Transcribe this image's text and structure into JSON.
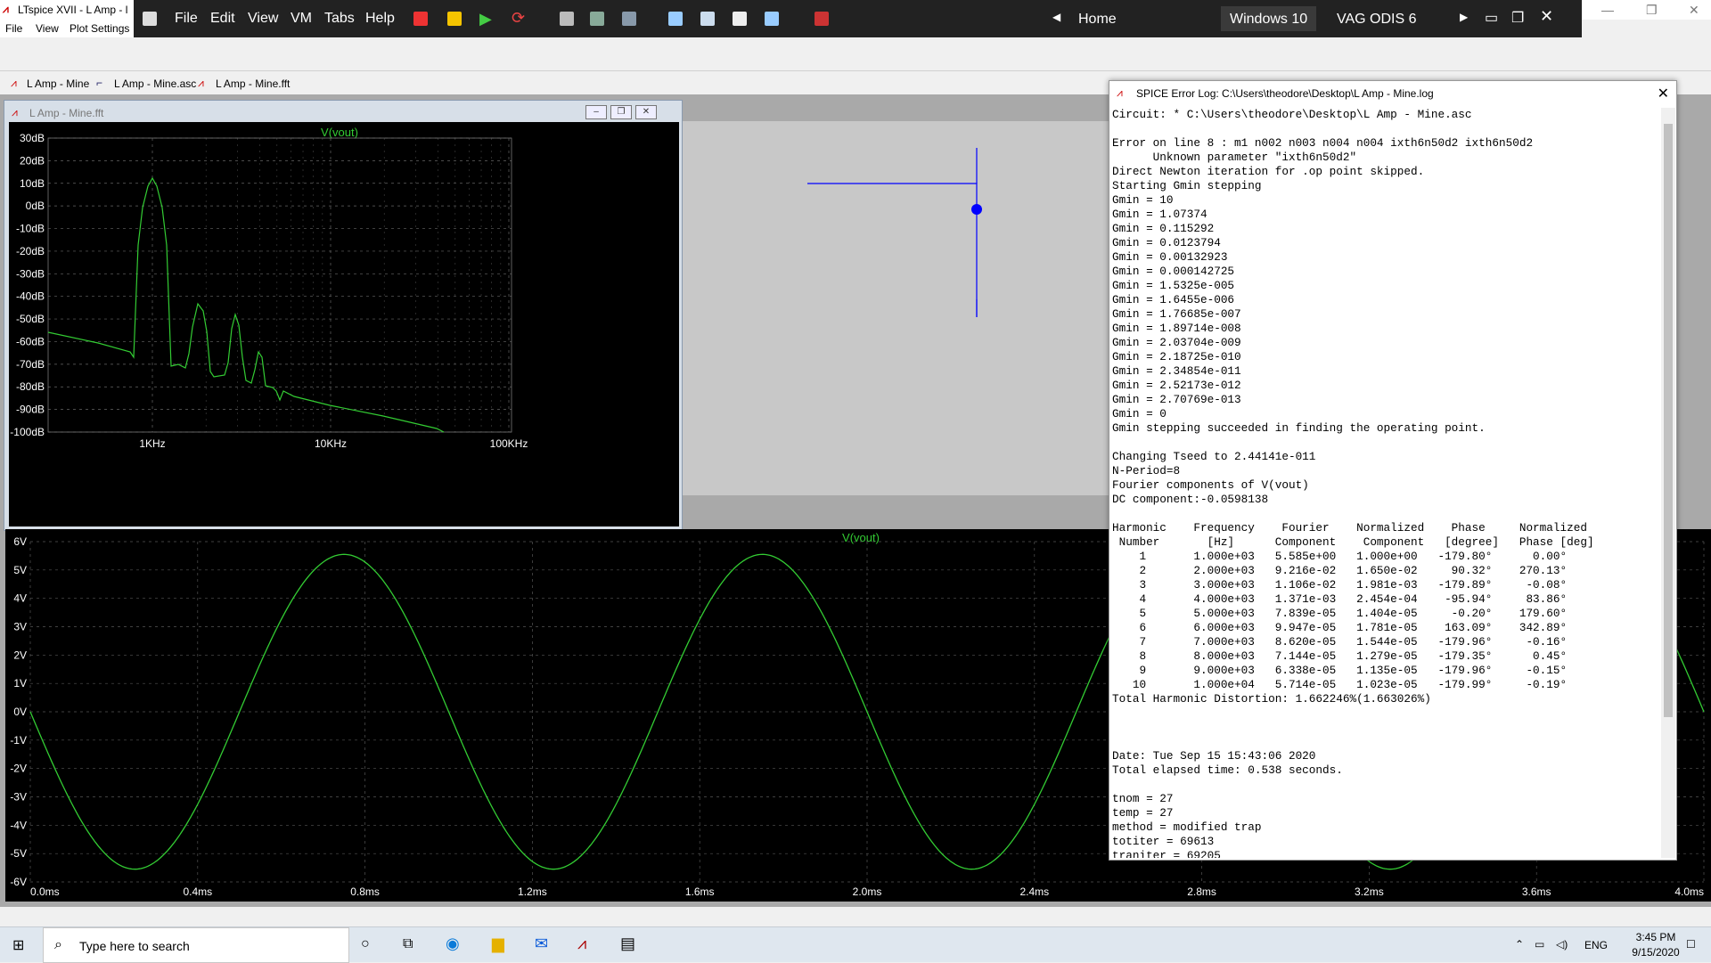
{
  "ltspice": {
    "title": "LTspice XVII - L Amp - l",
    "menu": [
      "File",
      "View",
      "Plot Settings"
    ]
  },
  "vm": {
    "menu": [
      "File",
      "Edit",
      "View",
      "VM",
      "Tabs",
      "Help"
    ],
    "tabs": [
      "Home",
      "Windows 10",
      "VAG ODIS 6"
    ]
  },
  "doc_tabs": [
    "L Amp - Mine",
    "L Amp - Mine.asc",
    "L Amp - Mine.fft"
  ],
  "fft_window": {
    "title": "L Amp - Mine.fft",
    "trace": "V(vout)",
    "y_ticks": [
      "30dB",
      "20dB",
      "10dB",
      "0dB",
      "-10dB",
      "-20dB",
      "-30dB",
      "-40dB",
      "-50dB",
      "-60dB",
      "-70dB",
      "-80dB",
      "-90dB",
      "-100dB"
    ],
    "x_ticks": [
      "1KHz",
      "10KHz",
      "100KHz"
    ]
  },
  "time_plot": {
    "trace": "V(vout)",
    "y_ticks": [
      "6V",
      "5V",
      "4V",
      "3V",
      "2V",
      "1V",
      "0V",
      "-1V",
      "-2V",
      "-3V",
      "-4V",
      "-5V",
      "-6V"
    ],
    "x_ticks": [
      "0.0ms",
      "0.4ms",
      "0.8ms",
      "1.2ms",
      "1.6ms",
      "2.0ms",
      "2.4ms",
      "2.8ms",
      "3.2ms",
      "3.6ms",
      "4.0ms"
    ]
  },
  "log_window": {
    "title": "SPICE Error Log: C:\\Users\\theodore\\Desktop\\L Amp - Mine.log",
    "lines": [
      "Circuit: * C:\\Users\\theodore\\Desktop\\L Amp - Mine.asc",
      "",
      "Error on line 8 : m1 n002 n003 n004 n004 ixth6n50d2 ixth6n50d2",
      "      Unknown parameter \"ixth6n50d2\"",
      "Direct Newton iteration for .op point skipped.",
      "Starting Gmin stepping",
      "Gmin = 10",
      "Gmin = 1.07374",
      "Gmin = 0.115292",
      "Gmin = 0.0123794",
      "Gmin = 0.00132923",
      "Gmin = 0.000142725",
      "Gmin = 1.5325e-005",
      "Gmin = 1.6455e-006",
      "Gmin = 1.76685e-007",
      "Gmin = 1.89714e-008",
      "Gmin = 2.03704e-009",
      "Gmin = 2.18725e-010",
      "Gmin = 2.34854e-011",
      "Gmin = 2.52173e-012",
      "Gmin = 2.70769e-013",
      "Gmin = 0",
      "Gmin stepping succeeded in finding the operating point.",
      "",
      "Changing Tseed to 2.44141e-011",
      "N-Period=8",
      "Fourier components of V(vout)",
      "DC component:-0.0598138",
      "",
      "Harmonic    Frequency    Fourier    Normalized    Phase     Normalized",
      " Number       [Hz]      Component    Component   [degree]   Phase [deg]",
      "    1       1.000e+03   5.585e+00   1.000e+00   -179.80°      0.00°",
      "    2       2.000e+03   9.216e-02   1.650e-02     90.32°    270.13°",
      "    3       3.000e+03   1.106e-02   1.981e-03   -179.89°     -0.08°",
      "    4       4.000e+03   1.371e-03   2.454e-04    -95.94°     83.86°",
      "    5       5.000e+03   7.839e-05   1.404e-05     -0.20°    179.60°",
      "    6       6.000e+03   9.947e-05   1.781e-05    163.09°    342.89°",
      "    7       7.000e+03   8.620e-05   1.544e-05   -179.96°     -0.16°",
      "    8       8.000e+03   7.144e-05   1.279e-05   -179.35°      0.45°",
      "    9       9.000e+03   6.338e-05   1.135e-05   -179.96°     -0.15°",
      "   10       1.000e+04   5.714e-05   1.023e-05   -179.99°     -0.19°",
      "Total Harmonic Distortion: 1.662246%(1.663026%)",
      "",
      "",
      "",
      "Date: Tue Sep 15 15:43:06 2020",
      "Total elapsed time: 0.538 seconds.",
      "",
      "tnom = 27",
      "temp = 27",
      "method = modified trap",
      "totiter = 69613",
      "traniter = 69205"
    ]
  },
  "taskbar": {
    "search_placeholder": "Type here to search",
    "lang": "ENG",
    "time": "3:45 PM",
    "date": "9/15/2020"
  },
  "colors": {
    "trace": "#33cc33",
    "plot_bg": "#000000",
    "schematic_wire": "#0000ff"
  }
}
